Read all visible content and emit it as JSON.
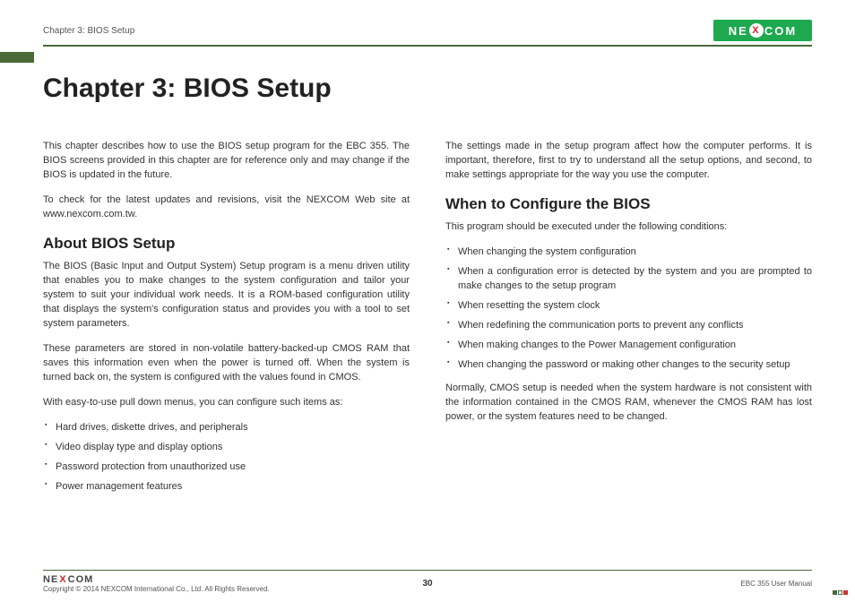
{
  "header": {
    "breadcrumb": "Chapter 3: BIOS Setup",
    "logo_left": "NE",
    "logo_x": "X",
    "logo_right": "COM"
  },
  "title": "Chapter 3: BIOS Setup",
  "col_left": {
    "p1": "This chapter describes how to use the BIOS setup program for the EBC 355. The BIOS screens provided in this chapter are for reference only and may change if the BIOS is updated in the future.",
    "p2": "To check for the latest updates and revisions, visit the NEXCOM Web site at www.nexcom.com.tw.",
    "h_about": "About BIOS Setup",
    "p3": "The BIOS (Basic Input and Output System) Setup program is a menu driven utility that enables you to make changes to the system configuration and tailor your system to suit your individual work needs. It is a ROM-based configuration utility that displays the system's configuration status and provides you with a tool to set system parameters.",
    "p4": "These parameters are stored in non-volatile battery-backed-up CMOS RAM that saves this information even when the power is turned off. When the system is turned back on, the system is configured with the values found in CMOS.",
    "p5": "With easy-to-use pull down menus, you can configure such items as:",
    "bullets": [
      "Hard drives, diskette drives, and peripherals",
      "Video display type and display options",
      "Password protection from unauthorized use",
      "Power management features"
    ]
  },
  "col_right": {
    "p1": "The settings made in the setup program affect how the computer performs. It is important, therefore, first to try to understand all the setup options, and second, to make settings appropriate for the way you use the computer.",
    "h_when": "When to Configure the BIOS",
    "p2": "This program should be executed under the following conditions:",
    "bullets": [
      "When changing the system configuration",
      "When a configuration error is detected by the system and you are prompted to make changes to the setup program",
      "When resetting the system clock",
      "When redefining the communication ports to prevent any conflicts",
      "When making changes to the Power Management configuration",
      "When changing the password or making other changes to the security setup"
    ],
    "p3": "Normally, CMOS setup is needed when the system hardware is not consistent with the information contained in the CMOS RAM, whenever the CMOS RAM has lost power, or the system features need to be changed."
  },
  "footer": {
    "logo_left": "NE",
    "logo_x": "X",
    "logo_right": "COM",
    "copyright": "Copyright © 2014 NEXCOM International Co., Ltd. All Rights Reserved.",
    "page": "30",
    "manual": "EBC 355 User Manual"
  }
}
